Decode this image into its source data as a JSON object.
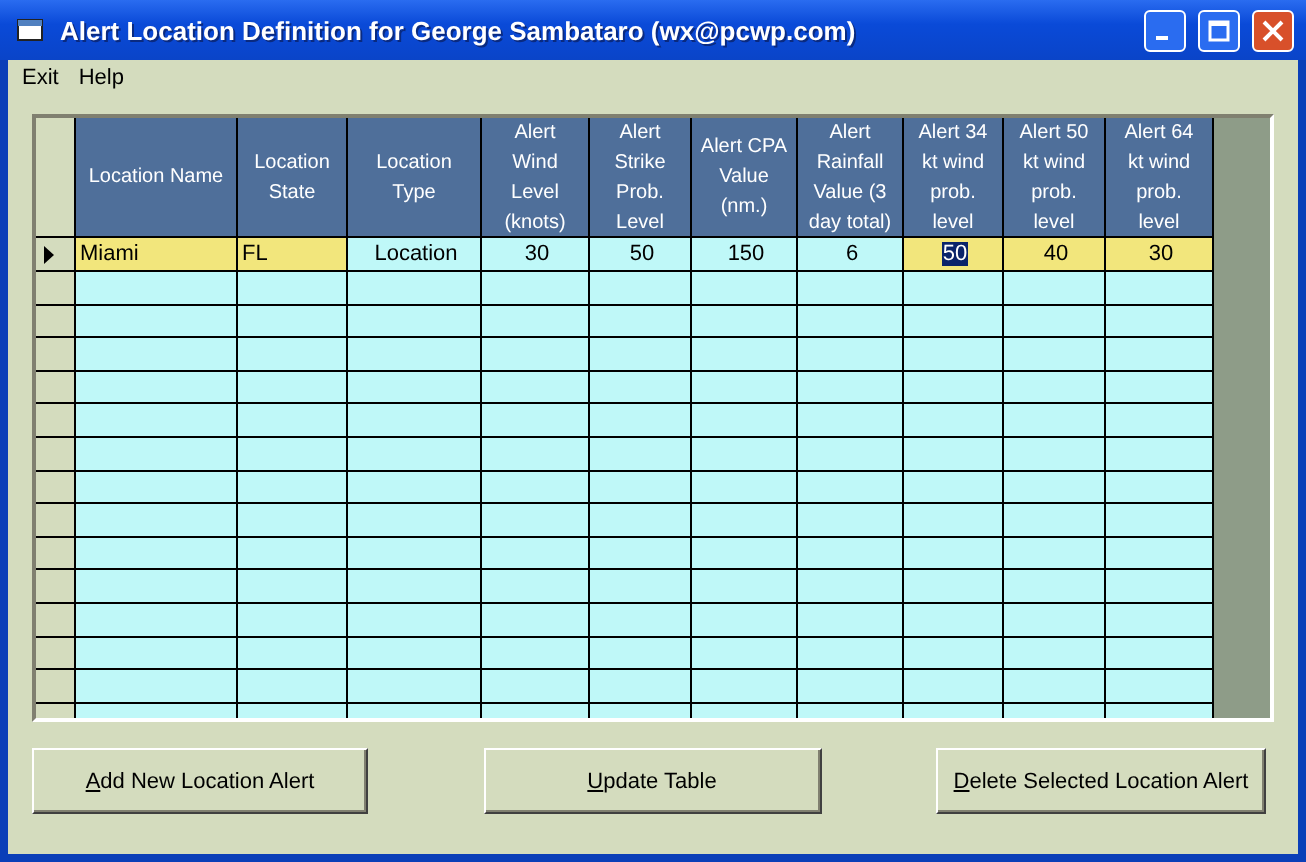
{
  "window": {
    "title": "Alert Location Definition for George Sambataro (wx@pcwp.com)"
  },
  "menu": [
    "Exit",
    "Help"
  ],
  "table": {
    "columns": [
      "Location Name",
      "Location State",
      "Location Type",
      "Alert Wind Level (knots)",
      "Alert Strike Prob. Level",
      "Alert CPA Value (nm.)",
      "Alert Rainfall Value (3 day total)",
      "Alert 34 kt wind prob. level",
      "Alert 50 kt wind prob. level",
      "Alert 64 kt wind prob. level"
    ],
    "rows": [
      {
        "current": true,
        "cells": [
          {
            "text": "Miami",
            "highlighted": true,
            "selected": false
          },
          {
            "text": "FL",
            "highlighted": true,
            "selected": false
          },
          {
            "text": "Location",
            "highlighted": false,
            "selected": false
          },
          {
            "text": "30",
            "highlighted": false,
            "selected": false
          },
          {
            "text": "50",
            "highlighted": false,
            "selected": false
          },
          {
            "text": "150",
            "highlighted": false,
            "selected": false
          },
          {
            "text": "6",
            "highlighted": false,
            "selected": false
          },
          {
            "text": "50",
            "highlighted": true,
            "selected": true
          },
          {
            "text": "40",
            "highlighted": true,
            "selected": false
          },
          {
            "text": "30",
            "highlighted": true,
            "selected": false
          }
        ]
      }
    ]
  },
  "buttons": [
    "Add New Location Alert",
    "Update Table",
    "Delete Selected Location Alert"
  ]
}
